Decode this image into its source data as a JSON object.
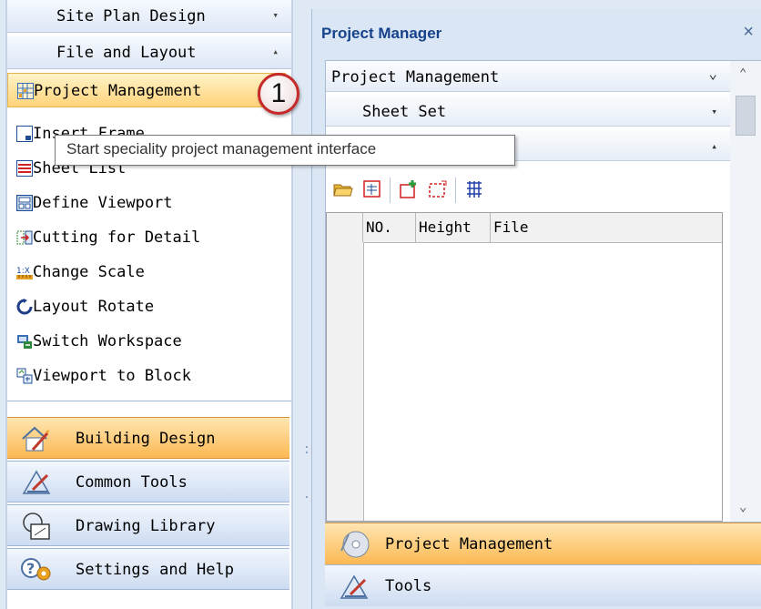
{
  "left_panel": {
    "sections": [
      {
        "label": "Site Plan Design",
        "arrow": "▾"
      },
      {
        "label": "File and Layout",
        "arrow": "▴"
      }
    ],
    "commands": [
      {
        "label": "Project Management",
        "icon": "project-grid-icon"
      },
      {
        "label": "Insert Frame",
        "icon": "frame-icon"
      },
      {
        "label": "Sheet List",
        "icon": "sheet-list-icon"
      },
      {
        "label": "Define Viewport",
        "icon": "viewport-icon"
      },
      {
        "label": "Cutting for Detail",
        "icon": "cut-detail-icon"
      },
      {
        "label": "Change Scale",
        "icon": "scale-icon"
      },
      {
        "label": "Layout Rotate",
        "icon": "rotate-icon"
      },
      {
        "label": "Switch Workspace",
        "icon": "workspace-icon"
      },
      {
        "label": "Viewport to Block",
        "icon": "block-icon"
      }
    ],
    "tabs": [
      {
        "label": "Building Design",
        "icon": "building-icon"
      },
      {
        "label": "Common Tools",
        "icon": "tools-icon"
      },
      {
        "label": "Drawing Library",
        "icon": "library-icon"
      },
      {
        "label": "Settings and Help",
        "icon": "settings-help-icon"
      }
    ]
  },
  "tooltip": "Start speciality project management interface",
  "callout": "1",
  "project_manager": {
    "title": "Project Manager",
    "close": "×",
    "dropdowns": [
      {
        "label": "Project Management",
        "arrow": "⌄"
      },
      {
        "label": "Sheet Set",
        "arrow": "▾"
      },
      {
        "label": "",
        "arrow": "▴"
      }
    ],
    "toolbar": [
      "open-folder-icon",
      "sheet-edit-icon",
      "add-sheet-icon",
      "new-sheet-icon",
      "building-grid-icon"
    ],
    "table_headers": [
      "NO.",
      "Height",
      "File"
    ],
    "scroll_up": "⌃",
    "scroll_down": "⌄",
    "tabs": [
      {
        "label": "Project Management",
        "icon": "disc-icon"
      },
      {
        "label": "Tools",
        "icon": "tools-icon"
      }
    ]
  },
  "colors": {
    "accent_orange": "#fbb852",
    "header_blue": "#15428b",
    "panel_bg": "#dfe8f5"
  }
}
